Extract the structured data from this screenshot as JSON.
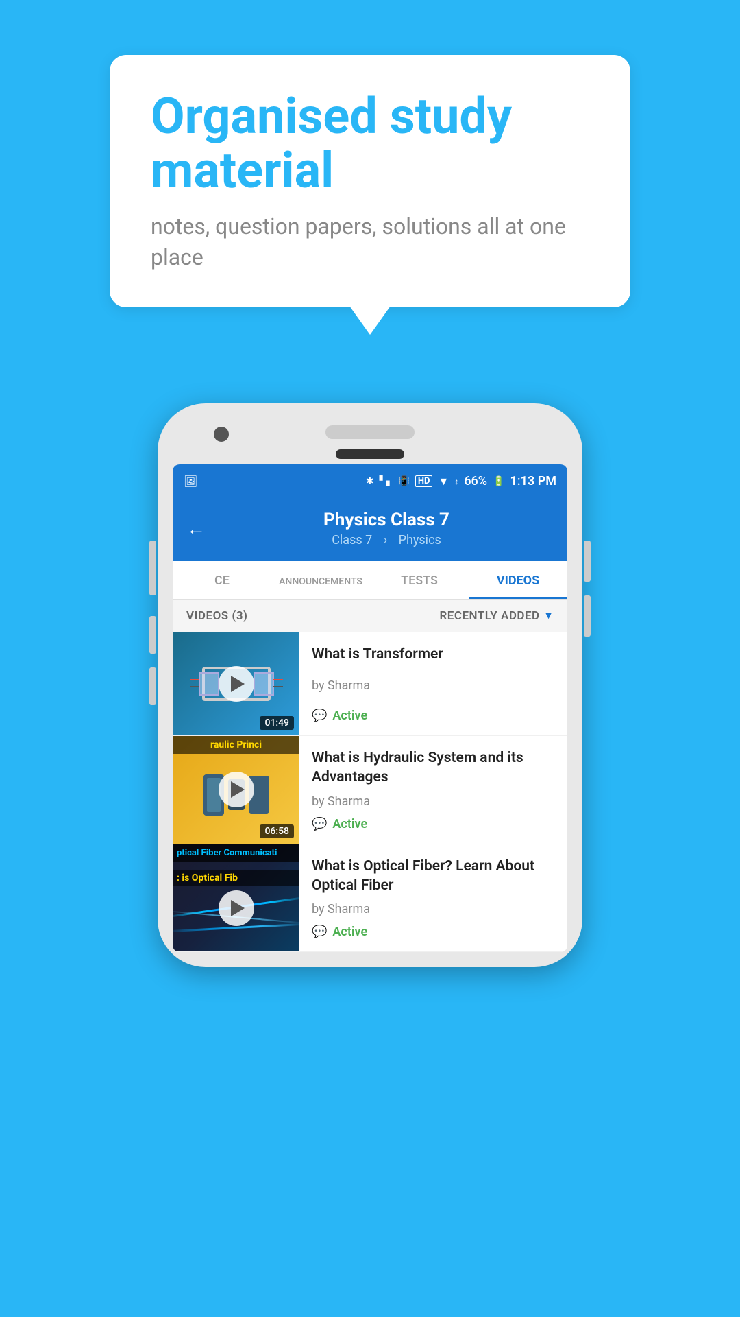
{
  "background_color": "#29B6F6",
  "speech_bubble": {
    "title": "Organised study material",
    "subtitle": "notes, question papers, solutions all at one place"
  },
  "phone": {
    "status_bar": {
      "battery": "66%",
      "time": "1:13 PM",
      "signal_text": "HD"
    },
    "header": {
      "back_label": "←",
      "title": "Physics Class 7",
      "breadcrumb_class": "Class 7",
      "breadcrumb_subject": "Physics"
    },
    "tabs": [
      {
        "id": "ce",
        "label": "CE",
        "active": false
      },
      {
        "id": "announcements",
        "label": "ANNOUNCEMENTS",
        "active": false
      },
      {
        "id": "tests",
        "label": "TESTS",
        "active": false
      },
      {
        "id": "videos",
        "label": "VIDEOS",
        "active": true
      }
    ],
    "filter_bar": {
      "count_label": "VIDEOS (3)",
      "sort_label": "RECENTLY ADDED"
    },
    "videos": [
      {
        "id": "v1",
        "title": "What is  Transformer",
        "author": "by Sharma",
        "status": "Active",
        "duration": "01:49",
        "thumb_bg": "transformer"
      },
      {
        "id": "v2",
        "title": "What is Hydraulic System and its Advantages",
        "author": "by Sharma",
        "status": "Active",
        "duration": "06:58",
        "thumb_bg": "hydraulic",
        "thumb_banner": "raulic Princi"
      },
      {
        "id": "v3",
        "title": "What is Optical Fiber? Learn About Optical Fiber",
        "author": "by Sharma",
        "status": "Active",
        "duration": "",
        "thumb_bg": "optical",
        "thumb_banner1": "ptical Fiber Communicati",
        "thumb_banner2": ": is Optical Fib"
      }
    ]
  }
}
